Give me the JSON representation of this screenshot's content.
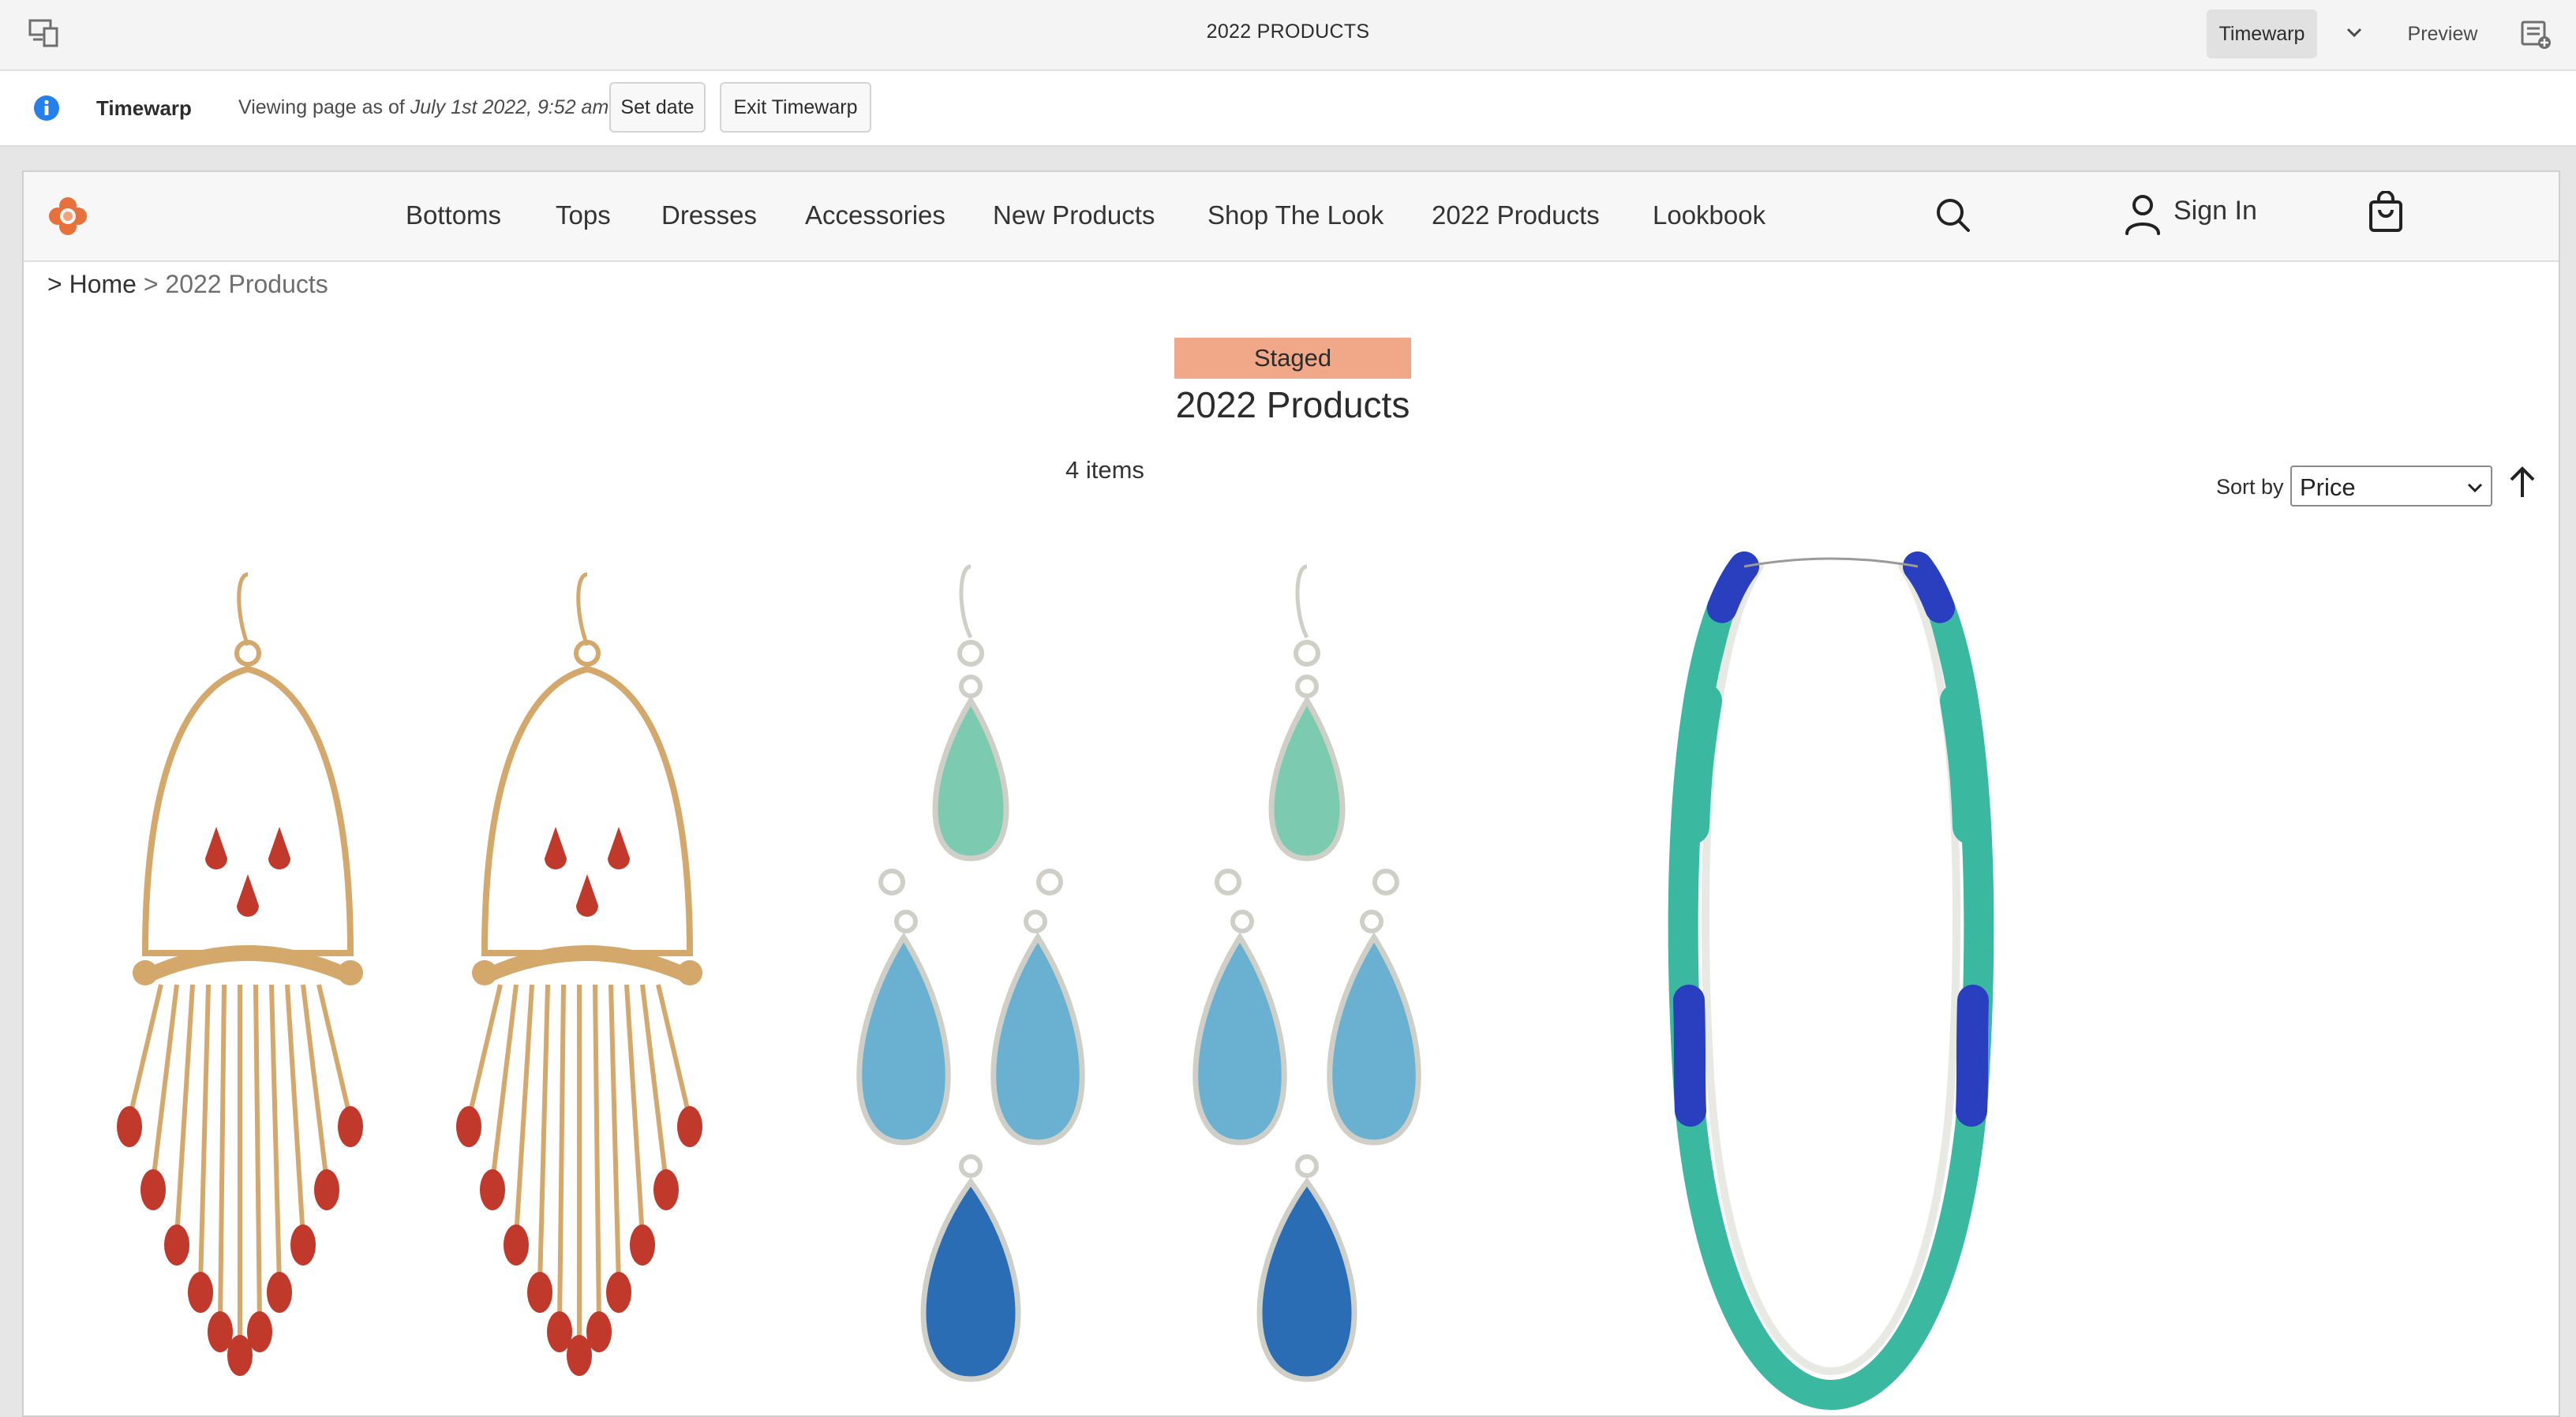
{
  "editor": {
    "title": "2022 PRODUCTS",
    "mode_button": "Timewarp",
    "preview_button": "Preview"
  },
  "timewarp": {
    "label": "Timewarp",
    "viewing_prefix": "Viewing page as of ",
    "viewing_date": "July 1st 2022, 9:52 am",
    "set_date_button": "Set date",
    "exit_button": "Exit Timewarp"
  },
  "site": {
    "nav": [
      "Bottoms",
      "Tops",
      "Dresses",
      "Accessories",
      "New Products",
      "Shop The Look",
      "2022 Products",
      "Lookbook"
    ],
    "sign_in": "Sign In",
    "breadcrumb": {
      "separator": ">",
      "home": "Home",
      "current": "2022 Products"
    },
    "badge": "Staged",
    "page_title": "2022 Products",
    "item_count": "4 items",
    "sort": {
      "label": "Sort by",
      "value": "Price"
    }
  },
  "products": [
    {
      "name": "red-tassel-earring-left"
    },
    {
      "name": "red-tassel-earring-right"
    },
    {
      "name": "teal-teardrop-earring-left"
    },
    {
      "name": "teal-teardrop-earring-right"
    },
    {
      "name": "beaded-necklace"
    }
  ],
  "colors": {
    "badge": "#f0a888",
    "info_icon": "#2680eb",
    "logo": "#e8703a",
    "earring_red": "#c0392b",
    "earring_gold": "#d4a76a",
    "gem_teal": "#7ccbb1",
    "gem_blue": "#6ab0d0",
    "gem_dark_blue": "#2a6db5",
    "bead_teal": "#3bb8a0",
    "bead_blue": "#2a3fbf"
  }
}
